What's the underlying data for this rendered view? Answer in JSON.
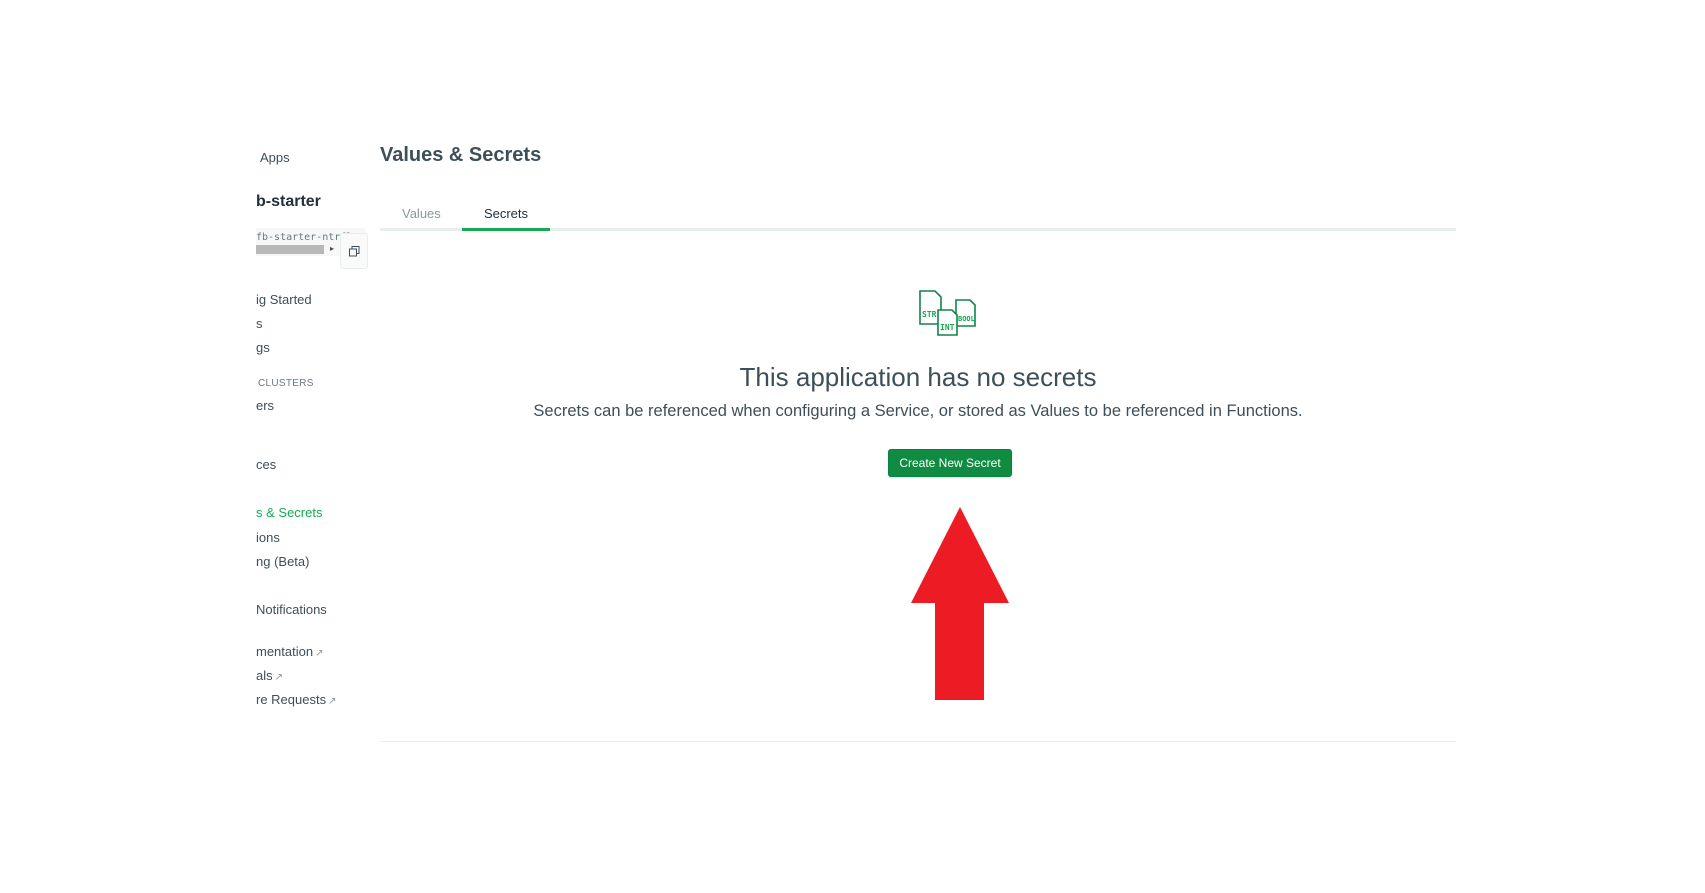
{
  "sidebar": {
    "apps_link": "Apps",
    "app_name": "b-starter",
    "app_id": "fb-starter-ntrfl",
    "items": [
      {
        "label": "ig Started"
      },
      {
        "label": "s"
      },
      {
        "label": "gs"
      },
      {
        "label": "CLUSTERS"
      },
      {
        "label": "ers"
      },
      {
        "label": "ces"
      },
      {
        "label": "s & Secrets"
      },
      {
        "label": "ions"
      },
      {
        "label": "ng (Beta)"
      },
      {
        "label": "Notifications"
      },
      {
        "label": "mentation"
      },
      {
        "label": "als"
      },
      {
        "label": "re Requests"
      }
    ]
  },
  "page": {
    "title": "Values & Secrets",
    "tabs": [
      {
        "label": "Values"
      },
      {
        "label": "Secrets"
      }
    ]
  },
  "empty_state": {
    "icon_labels": {
      "str": "STR",
      "int": "INT",
      "bool": "BOOL"
    },
    "title": "This application has no secrets",
    "description": "Secrets can be referenced when configuring a Service, or stored as Values to be referenced in Functions.",
    "button_label": "Create New Secret"
  },
  "annotation": {
    "arrow_color": "#ed1c24"
  },
  "colors": {
    "accent": "#13aa52",
    "button": "#0f8c42"
  }
}
